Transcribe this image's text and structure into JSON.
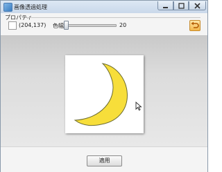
{
  "window": {
    "title": "画像透過処理",
    "icon": "image-icon",
    "controls": {
      "minimize": "minimize-icon",
      "maximize": "maximize-icon",
      "close": "close-icon"
    }
  },
  "properties": {
    "group_label": "プロパティ",
    "coords": "(204,137)",
    "tolerance_label": "色幅:",
    "tolerance_value": "20",
    "tolerance_fraction": 0.03,
    "undo_icon": "undo-arrow-icon"
  },
  "canvas": {
    "background": "#ffffff",
    "moon_color": "#f7de3a",
    "moon_stroke": "#6b6b30"
  },
  "footer": {
    "apply_label": "適用"
  }
}
